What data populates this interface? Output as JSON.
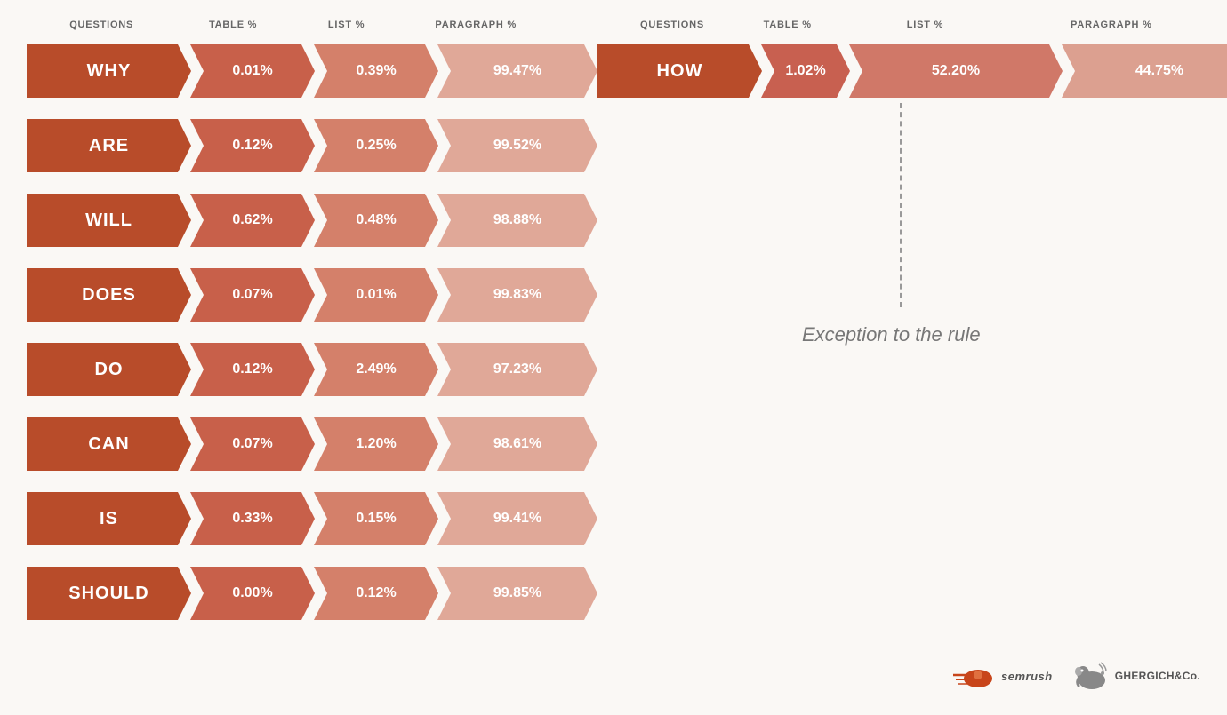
{
  "headers": {
    "left": {
      "questions": "QUESTIONS",
      "table": "TABLE %",
      "list": "LIST %",
      "paragraph": "PARAGRAPH %"
    },
    "right": {
      "questions": "QUESTIONS",
      "table": "TABLE %",
      "list": "LIST %",
      "paragraph": "PARAGRAPH %"
    }
  },
  "left_rows": [
    {
      "label": "WHY",
      "table": "0.01%",
      "list": "0.39%",
      "para": "99.47%"
    },
    {
      "label": "ARE",
      "table": "0.12%",
      "list": "0.25%",
      "para": "99.52%"
    },
    {
      "label": "WILL",
      "table": "0.62%",
      "list": "0.48%",
      "para": "98.88%"
    },
    {
      "label": "DOES",
      "table": "0.07%",
      "list": "0.01%",
      "para": "99.83%"
    },
    {
      "label": "DO",
      "table": "0.12%",
      "list": "2.49%",
      "para": "97.23%"
    },
    {
      "label": "CAN",
      "table": "0.07%",
      "list": "1.20%",
      "para": "98.61%"
    },
    {
      "label": "IS",
      "table": "0.33%",
      "list": "0.15%",
      "para": "99.41%"
    },
    {
      "label": "SHOULD",
      "table": "0.00%",
      "list": "0.12%",
      "para": "99.85%"
    }
  ],
  "right_rows": [
    {
      "label": "HOW",
      "table": "1.02%",
      "list": "52.20%",
      "para": "44.75%"
    }
  ],
  "exception_text": "Exception to the rule",
  "logo_semrush": "SEMrush",
  "logo_ghergich": "GHERGICH&Co."
}
